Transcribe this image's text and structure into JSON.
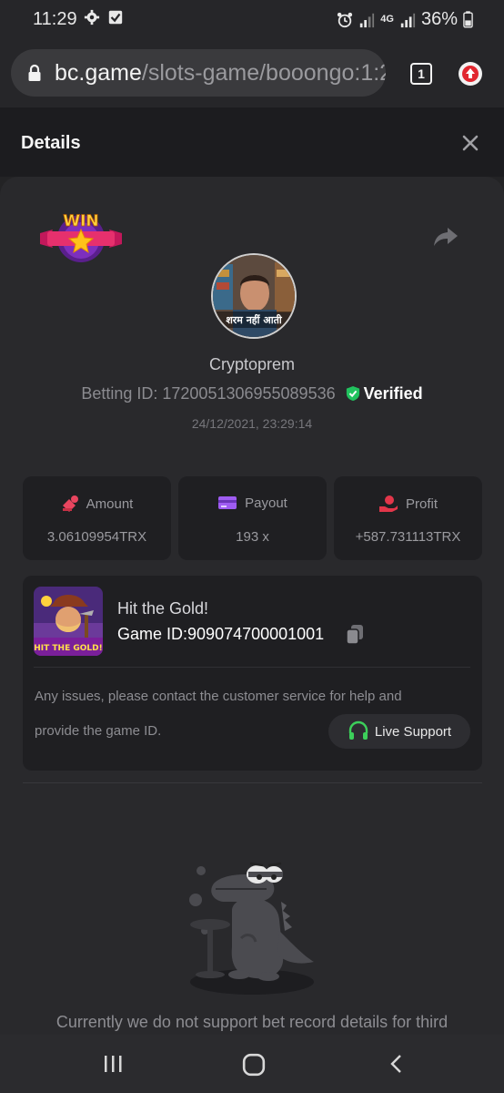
{
  "status_bar": {
    "time": "11:29",
    "network": "4G",
    "battery": "36%"
  },
  "browser": {
    "url_host": "bc.game",
    "url_path": "/slots-game/booongo:1:2",
    "tab_count": "1"
  },
  "details": {
    "title": "Details"
  },
  "bet": {
    "badge_text": "WIN",
    "avatar_caption": "शरम नहीं आती",
    "username": "Cryptoprem",
    "betting_id_label": "Betting ID:",
    "betting_id": "1720051306955089536",
    "verified_label": "Verified",
    "datetime": "24/12/2021, 23:29:14"
  },
  "stats": [
    {
      "label": "Amount",
      "value": "3.06109954TRX",
      "icon": "amount-icon",
      "color": "#e8455f"
    },
    {
      "label": "Payout",
      "value": "193 x",
      "icon": "payout-icon",
      "color": "#9f5cf2"
    },
    {
      "label": "Profit",
      "value": "+587.731113TRX",
      "icon": "profit-icon",
      "color": "#e2364a"
    }
  ],
  "game": {
    "thumb_text": "HIT THE GOLD!",
    "name": "Hit the Gold!",
    "id_label": "Game ID:",
    "id": "909074700001001",
    "issue_line1": "Any issues, please contact the customer service for help and",
    "issue_line2": "provide the game ID.",
    "support_label": "Live Support"
  },
  "footer": {
    "message": "Currently we do not support bet record details for third"
  },
  "colors": {
    "verified": "#21c25e",
    "support_icon": "#3ccf5a"
  }
}
